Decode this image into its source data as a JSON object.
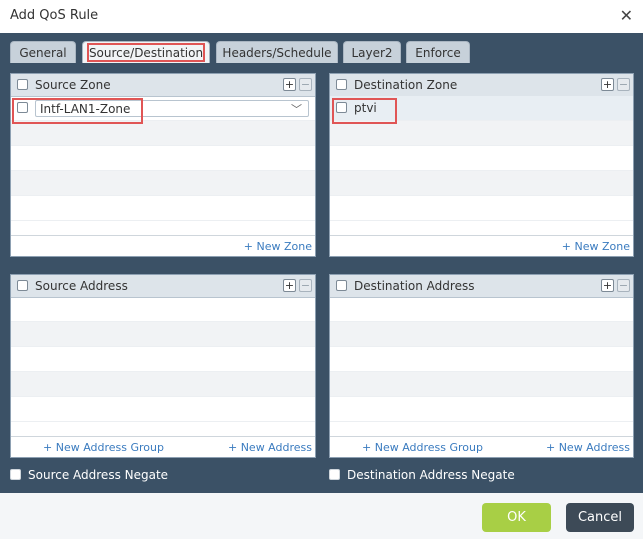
{
  "dialog": {
    "title": "Add QoS Rule"
  },
  "tabs": [
    {
      "label": "General"
    },
    {
      "label": "Source/Destination"
    },
    {
      "label": "Headers/Schedule"
    },
    {
      "label": "Layer2"
    },
    {
      "label": "Enforce"
    }
  ],
  "active_tab": "Source/Destination",
  "panels": {
    "source_zone": {
      "header": "Source Zone",
      "selected_value": "Intf-LAN1-Zone",
      "link": "+ New Zone"
    },
    "destination_zone": {
      "header": "Destination Zone",
      "row_value": "ptvi",
      "link": "+ New Zone"
    },
    "source_address": {
      "header": "Source Address",
      "link_group": "+ New Address Group",
      "link_address": "+ New Address"
    },
    "destination_address": {
      "header": "Destination Address",
      "link_group": "+ New Address Group",
      "link_address": "+ New Address"
    }
  },
  "negate": {
    "source": "Source Address Negate",
    "destination": "Destination Address Negate"
  },
  "buttons": {
    "ok": "OK",
    "cancel": "Cancel"
  },
  "colors": {
    "primary": "#a8cf45",
    "cancel": "#3d4a57",
    "dialog_body": "#3b5166",
    "highlight": "#e05555",
    "link": "#3a7bbf"
  }
}
